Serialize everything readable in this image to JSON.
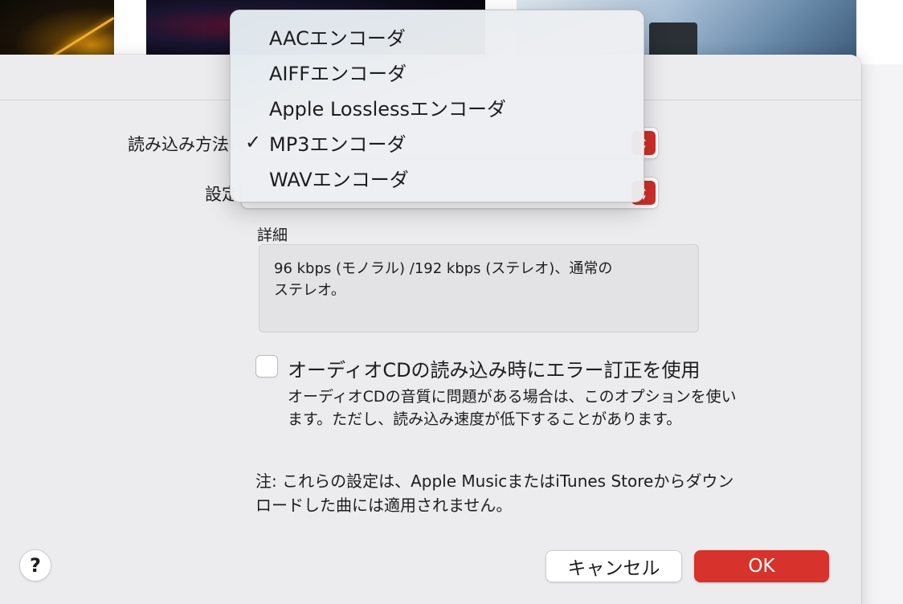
{
  "dialog": {
    "import_method_label": "読み込み方法:",
    "setting_label": "設定:",
    "details_label": "詳細",
    "details_text": "96 kbps (モノラル) /192 kbps (ステレオ)、通常の\nステレオ。",
    "error_correction": {
      "label": "オーディオCDの読み込み時にエラー訂正を使用",
      "checked": false,
      "description": "オーディオCDの音質に問題がある場合は、このオプションを使います。ただし、読み込み速度が低下することがあります。"
    },
    "note": "注: これらの設定は、Apple MusicまたはiTunes Storeからダウンロードした曲には適用されません。",
    "help_label": "?",
    "cancel_label": "キャンセル",
    "ok_label": "OK"
  },
  "menu": {
    "items": [
      {
        "label": "AACエンコーダ",
        "checked": false
      },
      {
        "label": "AIFFエンコーダ",
        "checked": false
      },
      {
        "label": "Apple Losslessエンコーダ",
        "checked": false
      },
      {
        "label": "MP3エンコーダ",
        "checked": true
      },
      {
        "label": "WAVエンコーダ",
        "checked": false
      }
    ],
    "check_glyph": "✓"
  },
  "colors": {
    "accent": "#d8322c",
    "popup_arrow": "#d12f2a",
    "dialog_bg": "#ececee"
  },
  "icons": {
    "popup_arrow": "chevron-up-down-icon",
    "checkmark": "checkmark-icon"
  }
}
